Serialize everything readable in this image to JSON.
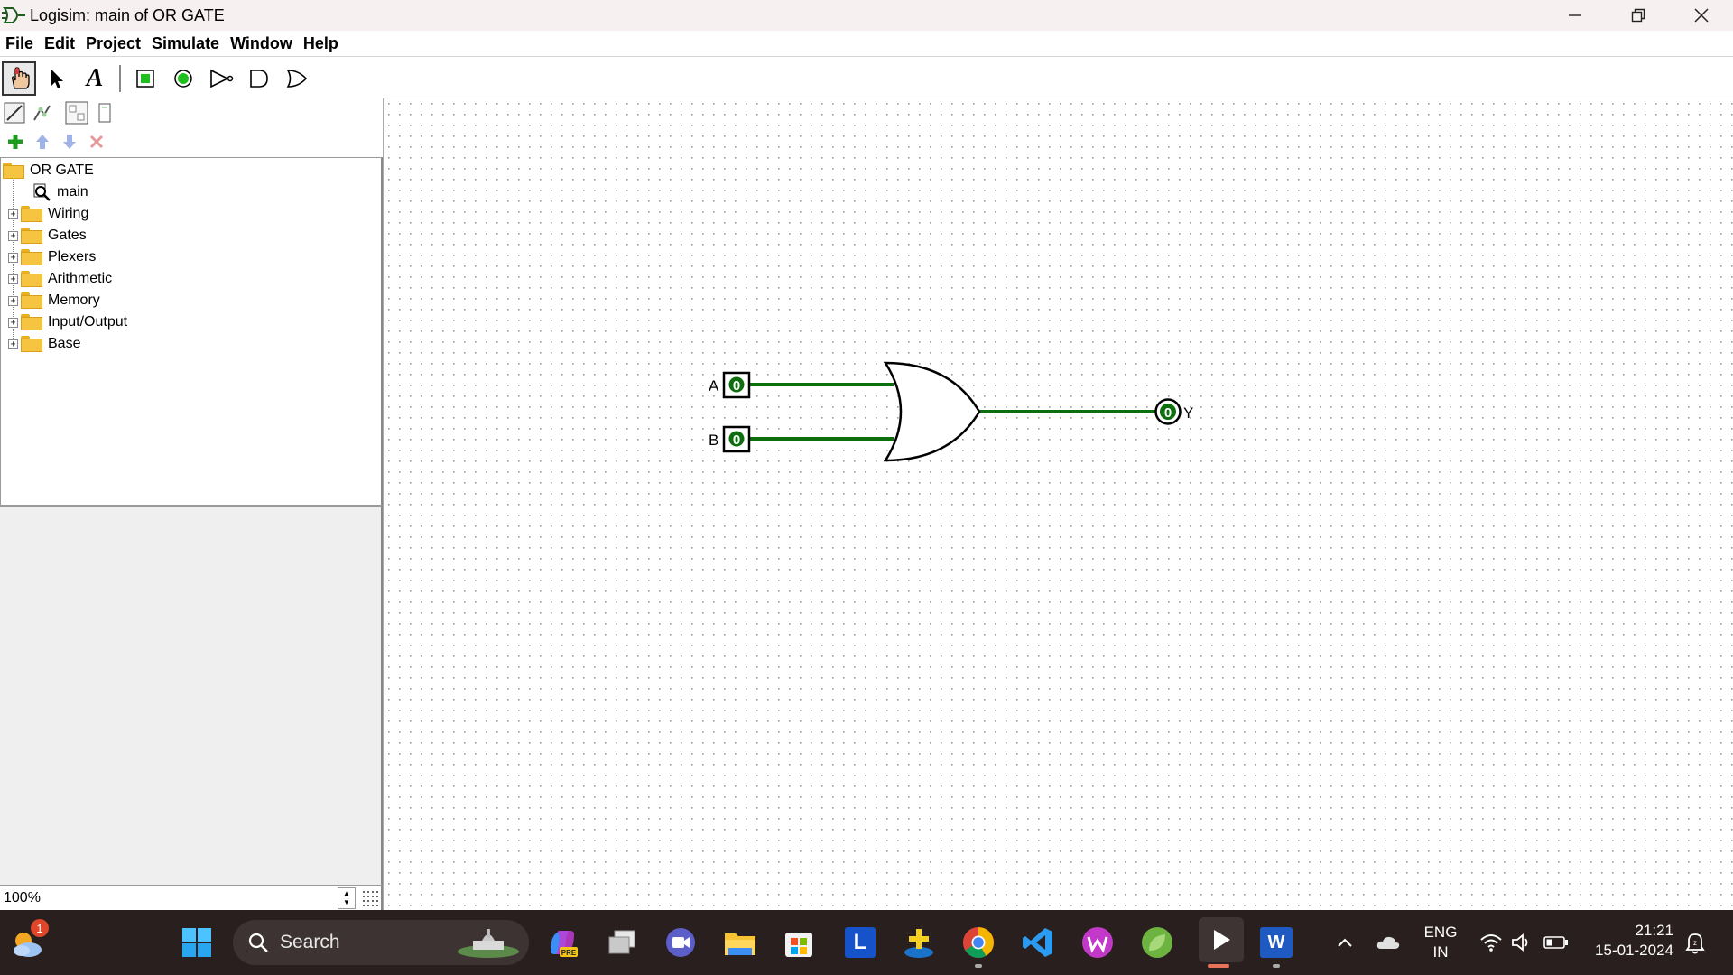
{
  "window": {
    "title": "Logisim: main of OR GATE"
  },
  "menu": [
    "File",
    "Edit",
    "Project",
    "Simulate",
    "Window",
    "Help"
  ],
  "toolbar": {
    "tools": [
      "poke-tool",
      "select-tool",
      "text-tool",
      "input-pin",
      "output-pin",
      "not-gate",
      "and-gate",
      "or-gate"
    ],
    "text_tool_glyph": "A"
  },
  "explorer": {
    "project": "OR GATE",
    "circuit": "main",
    "libraries": [
      "Wiring",
      "Gates",
      "Plexers",
      "Arithmetic",
      "Memory",
      "Input/Output",
      "Base"
    ]
  },
  "zoom": {
    "value": "100%"
  },
  "circuit": {
    "input_a": {
      "label": "A",
      "value": "0"
    },
    "input_b": {
      "label": "B",
      "value": "0"
    },
    "output_y": {
      "label": "Y",
      "value": "0"
    },
    "wire_color": "#0c6e0c"
  },
  "taskbar": {
    "weather_badge": "1",
    "search_placeholder": "Search",
    "pinned": [
      "copilot",
      "task-view",
      "teams",
      "file-explorer",
      "microsoft-store",
      "l-app",
      "game-app",
      "chrome",
      "vscode",
      "wps-office",
      "spring-tool",
      "logisim",
      "word"
    ],
    "l_app_glyph": "L",
    "word_glyph": "W",
    "pre_badge": "PRE",
    "language": "ENG",
    "region": "IN",
    "time": "21:21",
    "date": "15-01-2024"
  }
}
